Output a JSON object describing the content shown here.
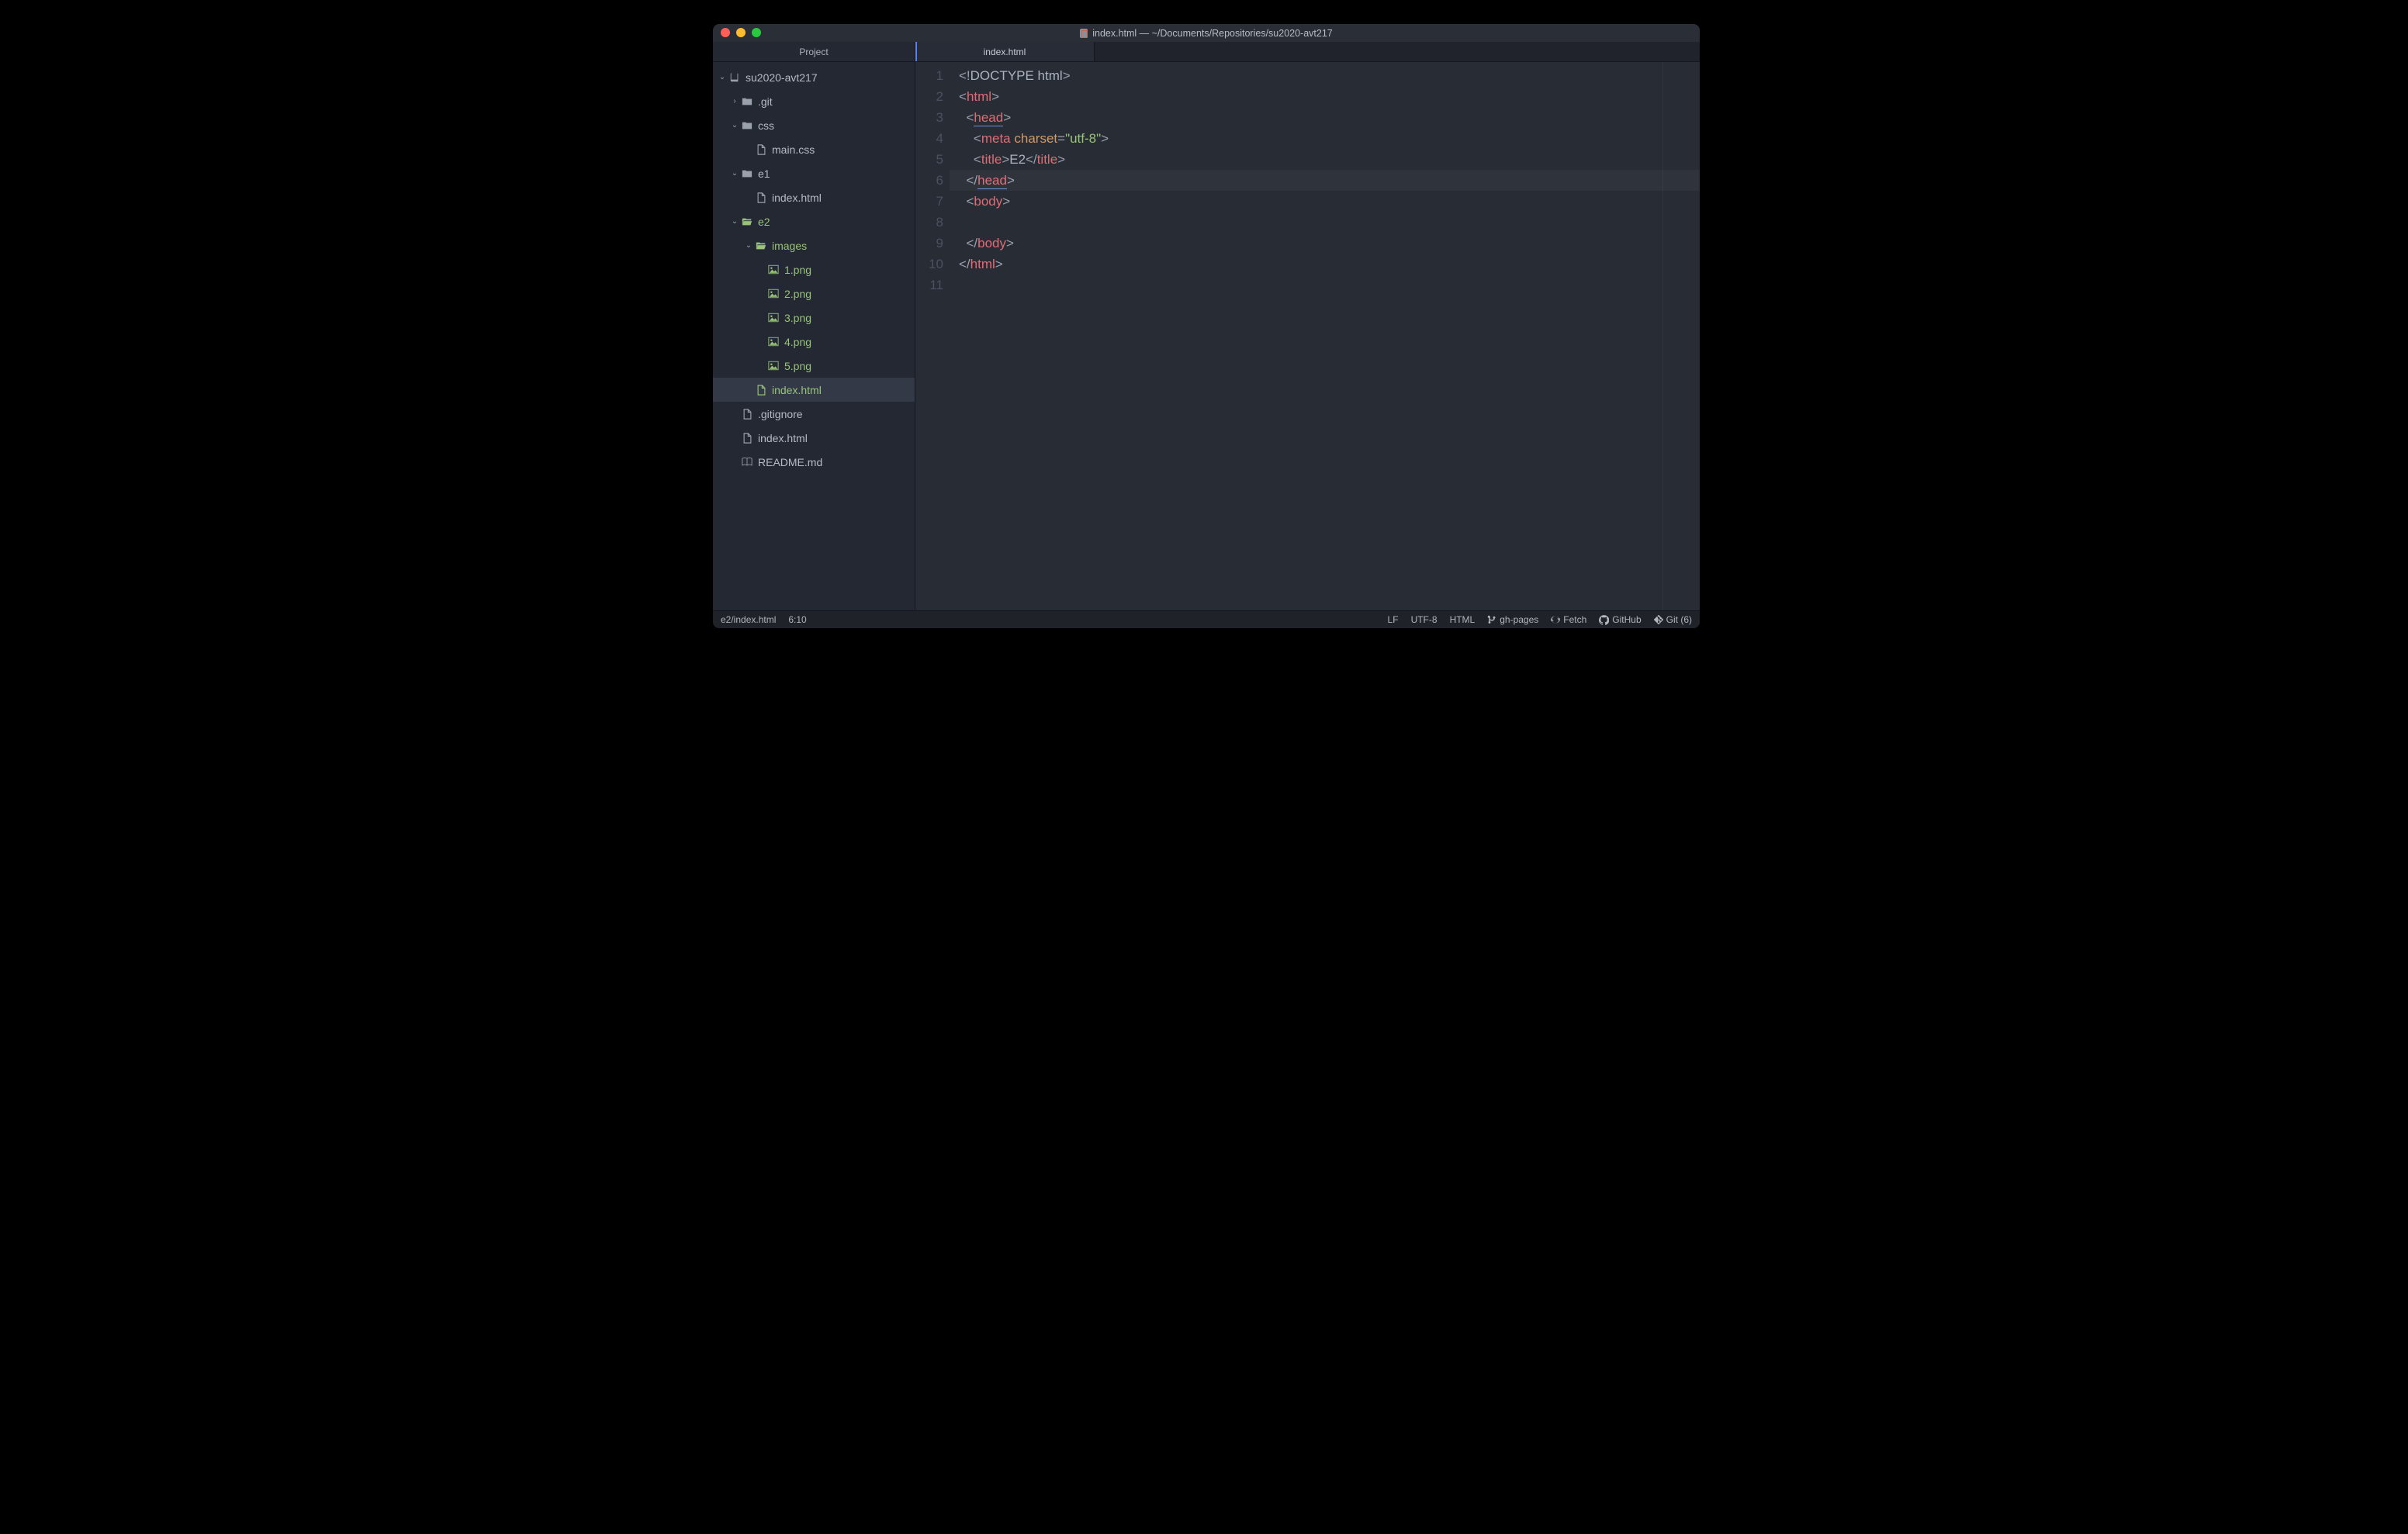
{
  "title": "index.html — ~/Documents/Repositories/su2020-avt217",
  "sidebar": {
    "tab": "Project",
    "rows": [
      {
        "name": "tree-root",
        "indent": 0,
        "chev": "down",
        "icon": "repo",
        "label": "su2020-avt217",
        "green": false
      },
      {
        "name": "tree-git",
        "indent": 1,
        "chev": "right",
        "icon": "folder",
        "label": ".git",
        "green": false
      },
      {
        "name": "tree-css",
        "indent": 1,
        "chev": "down",
        "icon": "folder",
        "label": "css",
        "green": false
      },
      {
        "name": "tree-maincss",
        "indent": 2,
        "chev": "",
        "icon": "file",
        "label": "main.css",
        "green": false
      },
      {
        "name": "tree-e1",
        "indent": 1,
        "chev": "down",
        "icon": "folder",
        "label": "e1",
        "green": false
      },
      {
        "name": "tree-e1-index",
        "indent": 2,
        "chev": "",
        "icon": "file",
        "label": "index.html",
        "green": false
      },
      {
        "name": "tree-e2",
        "indent": 1,
        "chev": "down",
        "icon": "folder-open",
        "label": "e2",
        "green": true
      },
      {
        "name": "tree-images",
        "indent": 2,
        "chev": "down",
        "icon": "folder-open",
        "label": "images",
        "green": true
      },
      {
        "name": "tree-1png",
        "indent": 3,
        "chev": "",
        "icon": "image",
        "label": "1.png",
        "green": true
      },
      {
        "name": "tree-2png",
        "indent": 3,
        "chev": "",
        "icon": "image",
        "label": "2.png",
        "green": true
      },
      {
        "name": "tree-3png",
        "indent": 3,
        "chev": "",
        "icon": "image",
        "label": "3.png",
        "green": true
      },
      {
        "name": "tree-4png",
        "indent": 3,
        "chev": "",
        "icon": "image",
        "label": "4.png",
        "green": true
      },
      {
        "name": "tree-5png",
        "indent": 3,
        "chev": "",
        "icon": "image",
        "label": "5.png",
        "green": true
      },
      {
        "name": "tree-e2-index",
        "indent": 2,
        "chev": "",
        "icon": "file",
        "label": "index.html",
        "green": true,
        "selected": true
      },
      {
        "name": "tree-gitignore",
        "indent": 1,
        "chev": "",
        "icon": "file",
        "label": ".gitignore",
        "green": false
      },
      {
        "name": "tree-root-index",
        "indent": 1,
        "chev": "",
        "icon": "file",
        "label": "index.html",
        "green": false
      },
      {
        "name": "tree-readme",
        "indent": 1,
        "chev": "",
        "icon": "book",
        "label": "README.md",
        "green": false
      }
    ]
  },
  "editor": {
    "tab": "index.html",
    "active_line_index": 5,
    "lines": [
      {
        "n": "1",
        "tokens": [
          {
            "c": "pun",
            "t": "<!"
          },
          {
            "c": "doctag",
            "t": "DOCTYPE html"
          },
          {
            "c": "pun",
            "t": ">"
          }
        ]
      },
      {
        "n": "2",
        "tokens": [
          {
            "c": "pun",
            "t": "<"
          },
          {
            "c": "tag",
            "t": "html"
          },
          {
            "c": "pun",
            "t": ">"
          }
        ]
      },
      {
        "n": "3",
        "tokens": [
          {
            "c": "",
            "t": "  "
          },
          {
            "c": "pun",
            "t": "<"
          },
          {
            "c": "tag uline",
            "t": "head"
          },
          {
            "c": "pun",
            "t": ">"
          }
        ]
      },
      {
        "n": "4",
        "tokens": [
          {
            "c": "",
            "t": "    "
          },
          {
            "c": "pun",
            "t": "<"
          },
          {
            "c": "tag",
            "t": "meta"
          },
          {
            "c": "",
            "t": " "
          },
          {
            "c": "attr",
            "t": "charset"
          },
          {
            "c": "pun",
            "t": "="
          },
          {
            "c": "str",
            "t": "\"utf-8\""
          },
          {
            "c": "pun",
            "t": ">"
          }
        ]
      },
      {
        "n": "5",
        "tokens": [
          {
            "c": "",
            "t": "    "
          },
          {
            "c": "pun",
            "t": "<"
          },
          {
            "c": "tag",
            "t": "title"
          },
          {
            "c": "pun",
            "t": ">"
          },
          {
            "c": "txt",
            "t": "E2"
          },
          {
            "c": "pun",
            "t": "</"
          },
          {
            "c": "tag",
            "t": "title"
          },
          {
            "c": "pun",
            "t": ">"
          }
        ]
      },
      {
        "n": "6",
        "tokens": [
          {
            "c": "",
            "t": "  "
          },
          {
            "c": "pun",
            "t": "</"
          },
          {
            "c": "tag uline",
            "t": "head"
          },
          {
            "c": "pun",
            "t": ">"
          }
        ]
      },
      {
        "n": "7",
        "tokens": [
          {
            "c": "",
            "t": "  "
          },
          {
            "c": "pun",
            "t": "<"
          },
          {
            "c": "tag",
            "t": "body"
          },
          {
            "c": "pun",
            "t": ">"
          }
        ]
      },
      {
        "n": "8",
        "tokens": []
      },
      {
        "n": "9",
        "tokens": [
          {
            "c": "",
            "t": "  "
          },
          {
            "c": "pun",
            "t": "</"
          },
          {
            "c": "tag",
            "t": "body"
          },
          {
            "c": "pun",
            "t": ">"
          }
        ]
      },
      {
        "n": "10",
        "tokens": [
          {
            "c": "pun",
            "t": "</"
          },
          {
            "c": "tag",
            "t": "html"
          },
          {
            "c": "pun",
            "t": ">"
          }
        ]
      },
      {
        "n": "11",
        "tokens": []
      }
    ]
  },
  "status": {
    "path": "e2/index.html",
    "cursor": "6:10",
    "eol": "LF",
    "encoding": "UTF-8",
    "lang": "HTML",
    "branch": "gh-pages",
    "fetch": "Fetch",
    "github": "GitHub",
    "git": "Git (6)"
  }
}
